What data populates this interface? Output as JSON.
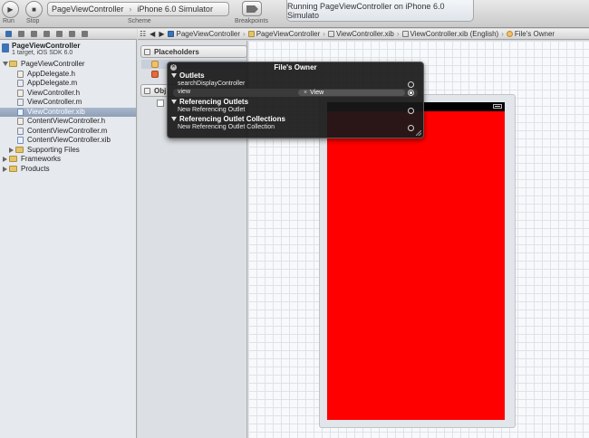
{
  "toolbar": {
    "run_label": "Run",
    "stop_label": "Stop",
    "scheme_project": "PageViewController",
    "scheme_destination": "iPhone 6.0 Simulator",
    "scheme_label": "Scheme",
    "breakpoints_label": "Breakpoints",
    "status_text": "Running PageViewController on iPhone 6.0 Simulato"
  },
  "navigator": {
    "project_name": "PageViewController",
    "project_subtitle": "1 target, iOS SDK 6.0",
    "items": [
      {
        "label": "PageViewController",
        "kind": "folder",
        "indent": 1,
        "expanded": true
      },
      {
        "label": "AppDelegate.h",
        "kind": "h",
        "indent": 2
      },
      {
        "label": "AppDelegate.m",
        "kind": "m",
        "indent": 2
      },
      {
        "label": "ViewController.h",
        "kind": "h",
        "indent": 2
      },
      {
        "label": "ViewController.m",
        "kind": "m",
        "indent": 2
      },
      {
        "label": "ViewController.xib",
        "kind": "xib",
        "indent": 2,
        "selected": true
      },
      {
        "label": "ContentViewController.h",
        "kind": "h",
        "indent": 2
      },
      {
        "label": "ContentViewController.m",
        "kind": "m",
        "indent": 2
      },
      {
        "label": "ContentViewController.xib",
        "kind": "xib",
        "indent": 2
      },
      {
        "label": "Supporting Files",
        "kind": "folder",
        "indent": 2,
        "expanded": false
      },
      {
        "label": "Frameworks",
        "kind": "folder",
        "indent": 1,
        "expanded": false
      },
      {
        "label": "Products",
        "kind": "folder",
        "indent": 1,
        "expanded": false
      }
    ]
  },
  "jumpbar": {
    "crumbs": [
      "PageViewController",
      "PageViewController",
      "ViewController.xib",
      "ViewController.xib (English)",
      "File's Owner"
    ]
  },
  "outline": {
    "placeholders_label": "Placeholders",
    "objects_label": "Obj"
  },
  "hud": {
    "title": "File's Owner",
    "outlets_label": "Outlets",
    "outlet_1": "searchDisplayController",
    "outlet_2": "view",
    "outlet_2_connection": "View",
    "referencing_outlets_label": "Referencing Outlets",
    "new_referencing_outlet": "New Referencing Outlet",
    "referencing_collections_label": "Referencing Outlet Collections",
    "new_referencing_collection": "New Referencing Outlet Collection"
  },
  "colors": {
    "view_background": "#ff0000",
    "selection": "#8e9fb7"
  }
}
